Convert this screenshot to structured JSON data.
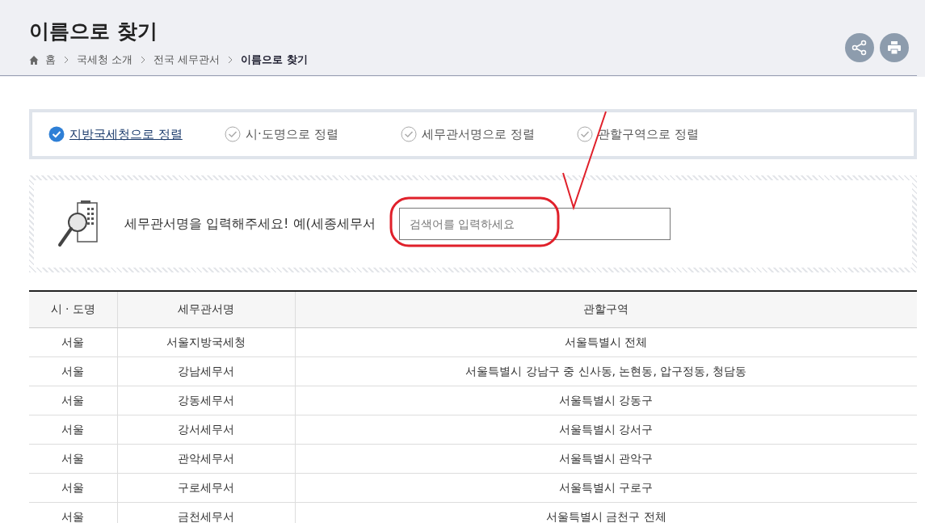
{
  "page_title": "이름으로 찾기",
  "breadcrumb": [
    "홈",
    "국세청 소개",
    "전국 세무관서",
    "이름으로 찾기"
  ],
  "sort_options": [
    {
      "label": "지방국세청으로 정렬",
      "selected": true
    },
    {
      "label": "시·도명으로 정렬",
      "selected": false
    },
    {
      "label": "세무관서명으로 정렬",
      "selected": false
    },
    {
      "label": "관할구역으로 정렬",
      "selected": false
    }
  ],
  "search": {
    "prompt": "세무관서명을 입력해주세요! 예(세종세무서",
    "placeholder": "검색어를 입력하세요"
  },
  "table": {
    "columns": [
      "시 · 도명",
      "세무관서명",
      "관할구역"
    ],
    "rows": [
      [
        "서울",
        "서울지방국세청",
        "서울특별시 전체"
      ],
      [
        "서울",
        "강남세무서",
        "서울특별시 강남구 중 신사동, 논현동, 압구정동, 청담동"
      ],
      [
        "서울",
        "강동세무서",
        "서울특별시 강동구"
      ],
      [
        "서울",
        "강서세무서",
        "서울특별시 강서구"
      ],
      [
        "서울",
        "관악세무서",
        "서울특별시 관악구"
      ],
      [
        "서울",
        "구로세무서",
        "서울특별시 구로구"
      ],
      [
        "서울",
        "금천세무서",
        "서울특별시 금천구 전체"
      ]
    ]
  }
}
